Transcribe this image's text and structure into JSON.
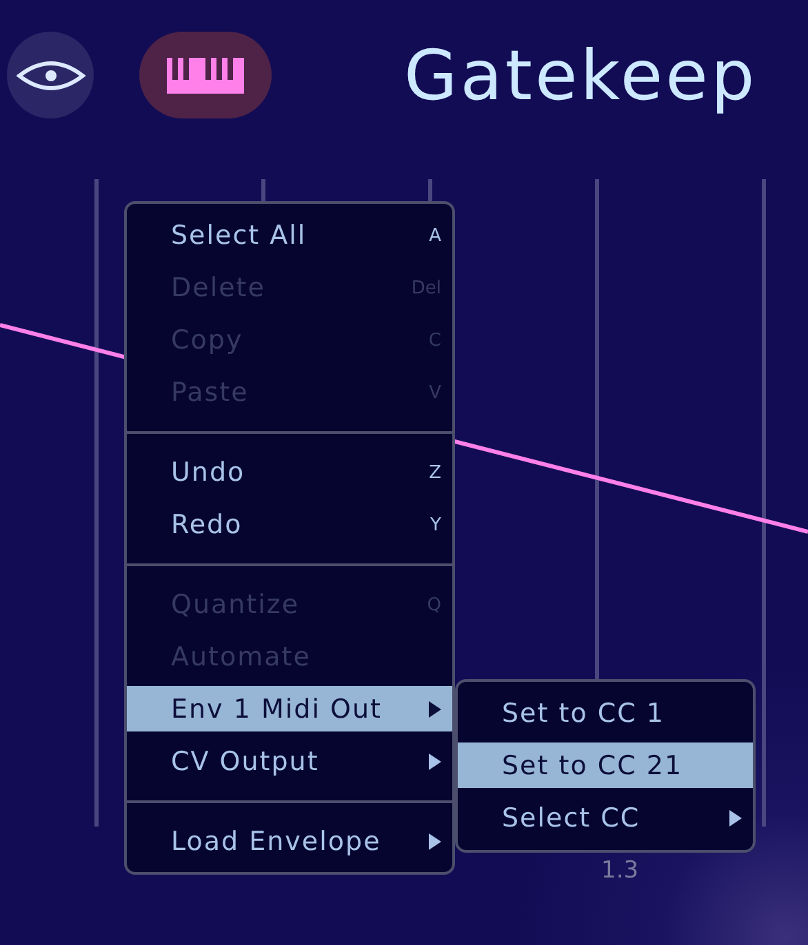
{
  "toolbar": {
    "buttons": [
      {
        "kind": "eye",
        "on": false
      },
      {
        "kind": "keyboard",
        "on": true
      }
    ],
    "title": "Gatekeep"
  },
  "graph": {
    "axis_label": "1.3"
  },
  "context_menu": {
    "items": [
      {
        "kind": "item",
        "label": "Select All",
        "shortcut": "A",
        "disabled": false,
        "selected": false
      },
      {
        "kind": "item",
        "label": "Delete",
        "shortcut": "Del",
        "disabled": true,
        "selected": false
      },
      {
        "kind": "item",
        "label": "Copy",
        "shortcut": "C",
        "disabled": true,
        "selected": false
      },
      {
        "kind": "item",
        "label": "Paste",
        "shortcut": "V",
        "disabled": true,
        "selected": false
      },
      {
        "kind": "separator"
      },
      {
        "kind": "item",
        "label": "Undo",
        "shortcut": "Z",
        "disabled": false,
        "selected": false
      },
      {
        "kind": "item",
        "label": "Redo",
        "shortcut": "Y",
        "disabled": false,
        "selected": false
      },
      {
        "kind": "separator"
      },
      {
        "kind": "item",
        "label": "Quantize",
        "shortcut": "Q",
        "disabled": true,
        "selected": false
      },
      {
        "kind": "item",
        "label": "Automate",
        "disabled": true,
        "selected": false
      },
      {
        "kind": "submenu",
        "label": "Env 1 Midi Out",
        "disabled": false,
        "selected": true
      },
      {
        "kind": "submenu",
        "label": "CV Output",
        "disabled": false,
        "selected": false
      },
      {
        "kind": "separator"
      },
      {
        "kind": "submenu",
        "label": "Load Envelope",
        "disabled": false,
        "selected": false
      }
    ]
  },
  "submenu": {
    "items": [
      {
        "kind": "item",
        "label": "Set to CC 1",
        "selected": false
      },
      {
        "kind": "item",
        "label": "Set to CC 21",
        "selected": true
      },
      {
        "kind": "submenu",
        "label": "Select CC",
        "selected": false
      }
    ]
  }
}
